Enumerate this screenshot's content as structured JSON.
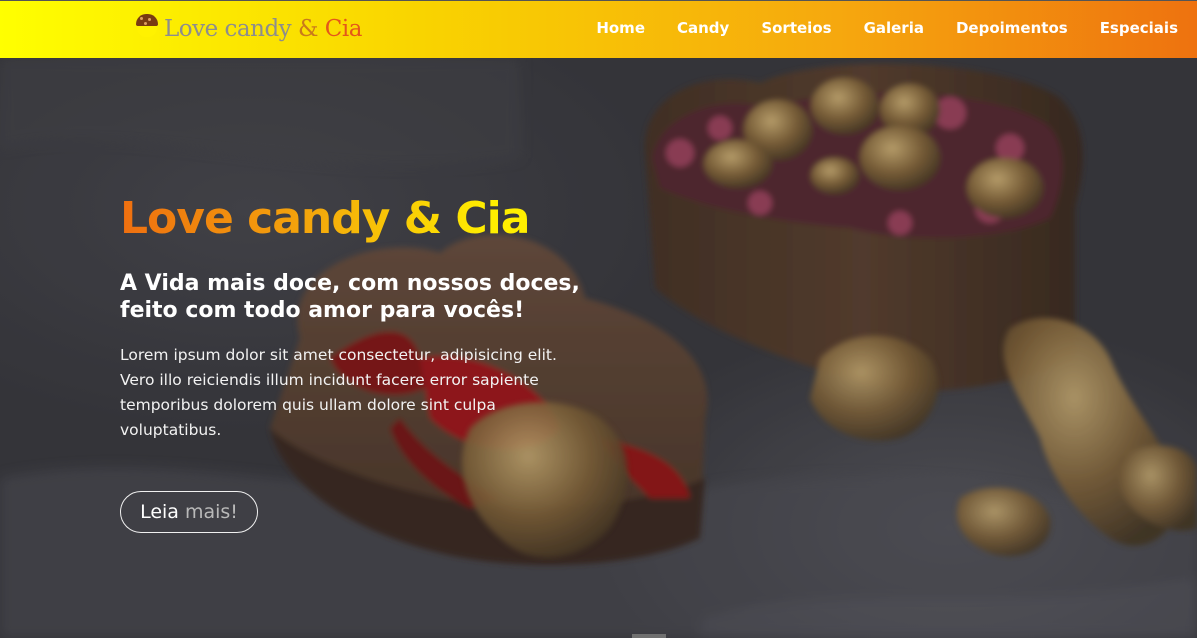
{
  "brand": {
    "part1": "Love candy",
    "amp": "&",
    "part2": "Cia",
    "icon": "candy-icon"
  },
  "nav": {
    "items": [
      "Home",
      "Candy",
      "Sorteios",
      "Galeria",
      "Depoimentos",
      "Especiais"
    ]
  },
  "hero": {
    "title": "Love candy & Cia",
    "subtitle": "A Vida mais doce, com nossos doces, feito com todo amor para vocês!",
    "body": "Lorem ipsum dolor sit amet consectetur, adipisicing elit. Vero illo reiciendis illum incidunt facere error sapiente temporibus dolorem quis ullam dolore sint culpa voluptatibus.",
    "button_word1": "Leia",
    "button_word2": "mais!"
  },
  "colors": {
    "header_gradient_start": "#ffff00",
    "header_gradient_end": "#ee720f",
    "title_gradient_start": "#ef6f10",
    "title_gradient_end": "#ffee00"
  }
}
